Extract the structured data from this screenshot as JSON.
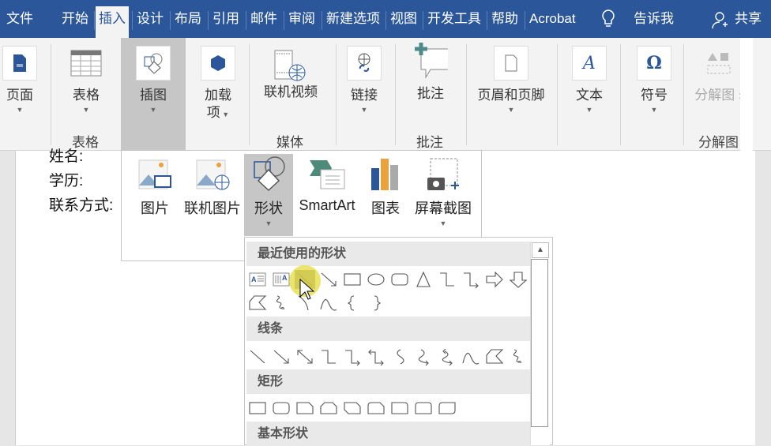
{
  "tabs": [
    {
      "label": "文件"
    },
    {
      "label": "开始"
    },
    {
      "label": "插入",
      "active": true
    },
    {
      "label": "设计"
    },
    {
      "label": "布局"
    },
    {
      "label": "引用"
    },
    {
      "label": "邮件"
    },
    {
      "label": "审阅"
    },
    {
      "label": "新建选项"
    },
    {
      "label": "视图"
    },
    {
      "label": "开发工具"
    },
    {
      "label": "帮助"
    },
    {
      "label": "Acrobat"
    }
  ],
  "tell_me": "告诉我",
  "share": "共享",
  "ribbon": {
    "buttons": {
      "pages": "页面",
      "table": "表格",
      "illustrations": "插图",
      "addins_1": "加载",
      "addins_2": "项",
      "online_video": "联机视频",
      "links": "链接",
      "comment": "批注",
      "header_footer": "页眉和页脚",
      "text": "文本",
      "symbols": "符号",
      "exploded": "分解图"
    },
    "groups": {
      "table": "表格",
      "media": "媒体",
      "comments": "批注",
      "exploded": "分解图"
    }
  },
  "document": {
    "lines": [
      "姓名:",
      "学历:",
      "联系方式:"
    ]
  },
  "illustrations_menu": {
    "pictures": "图片",
    "online_pictures": "联机图片",
    "shapes": "形状",
    "smartart": "SmartArt",
    "chart": "图表",
    "screenshot": "屏幕截图"
  },
  "shapes_menu": {
    "sections": {
      "recent": "最近使用的形状",
      "lines": "线条",
      "rectangles": "矩形",
      "basic": "基本形状"
    },
    "recent_row1": [
      "textbox",
      "vertical-textbox",
      "line",
      "arrow",
      "rect",
      "oval",
      "rounded-rect",
      "triangle",
      "elbow",
      "elbow-arrow",
      "right-arrow",
      "down-arrow"
    ],
    "recent_row2": [
      "freeform",
      "scribble",
      "arc",
      "curve",
      "left-brace",
      "right-brace"
    ],
    "lines_row": [
      "line",
      "arrow",
      "double-arrow",
      "elbow",
      "elbow-arrow",
      "elbow-double-arrow",
      "curve-connector",
      "curve-arrow",
      "curve-double-arrow",
      "curve",
      "freeform",
      "scribble"
    ],
    "rect_row": [
      "rect",
      "rounded-rect",
      "snip1-rect",
      "snip2-same-rect",
      "snip2-diag-rect",
      "snip-round-rect",
      "round1-rect",
      "round2-same-rect",
      "round2-diag-rect"
    ]
  }
}
